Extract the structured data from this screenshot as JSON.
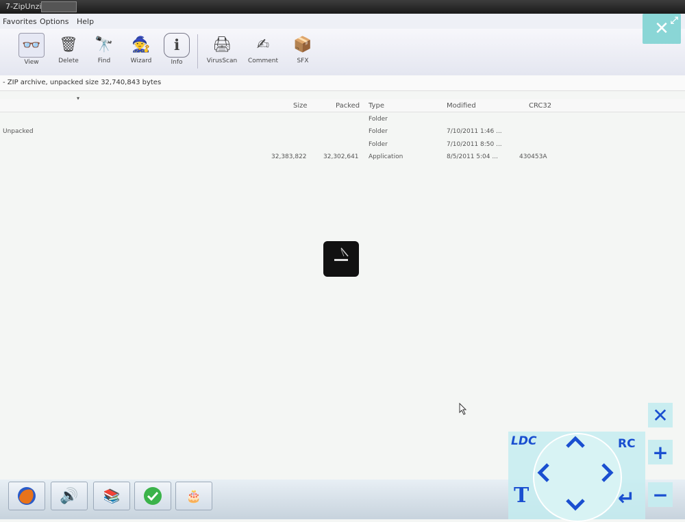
{
  "window": {
    "title": "7-ZipUnzip"
  },
  "menu": {
    "items": [
      "Favorites",
      "Options",
      "Help"
    ]
  },
  "toolbar": {
    "buttons": [
      {
        "label": "View",
        "icon": "view-icon"
      },
      {
        "label": "Delete",
        "icon": "delete-icon"
      },
      {
        "label": "Find",
        "icon": "find-icon"
      },
      {
        "label": "Wizard",
        "icon": "wizard-icon"
      },
      {
        "label": "Info",
        "icon": "info-icon"
      },
      {
        "label": "VirusScan",
        "icon": "virusscan-icon"
      },
      {
        "label": "Comment",
        "icon": "comment-icon"
      },
      {
        "label": "SFX",
        "icon": "sfx-icon"
      }
    ]
  },
  "archive_info": "- ZIP archive, unpacked size 32,740,843 bytes",
  "list": {
    "columns": [
      "Size",
      "Packed",
      "Type",
      "Modified",
      "CRC32"
    ],
    "rows": [
      {
        "name": "",
        "size": "",
        "packed": "",
        "type": "Folder",
        "modified": "",
        "crc": ""
      },
      {
        "name": "Unpacked",
        "size": "",
        "packed": "",
        "type": "Folder",
        "modified": "7/10/2011 1:46 ...",
        "crc": ""
      },
      {
        "name": "",
        "size": "",
        "packed": "",
        "type": "Folder",
        "modified": "7/10/2011 8:50 ...",
        "crc": ""
      },
      {
        "name": "",
        "size": "32,383,822",
        "packed": "32,302,641",
        "type": "Application",
        "modified": "8/5/2011 5:04 ...",
        "crc": "430453A"
      }
    ]
  },
  "remote_controls": {
    "left_double_click": "LDC",
    "right_click": "RC",
    "text": "T",
    "close": "✕",
    "zoom_in": "+",
    "zoom_out": "−",
    "enter": "↵"
  },
  "colors": {
    "accent": "#1a4fd0",
    "overlay": "#c4ecf0"
  }
}
